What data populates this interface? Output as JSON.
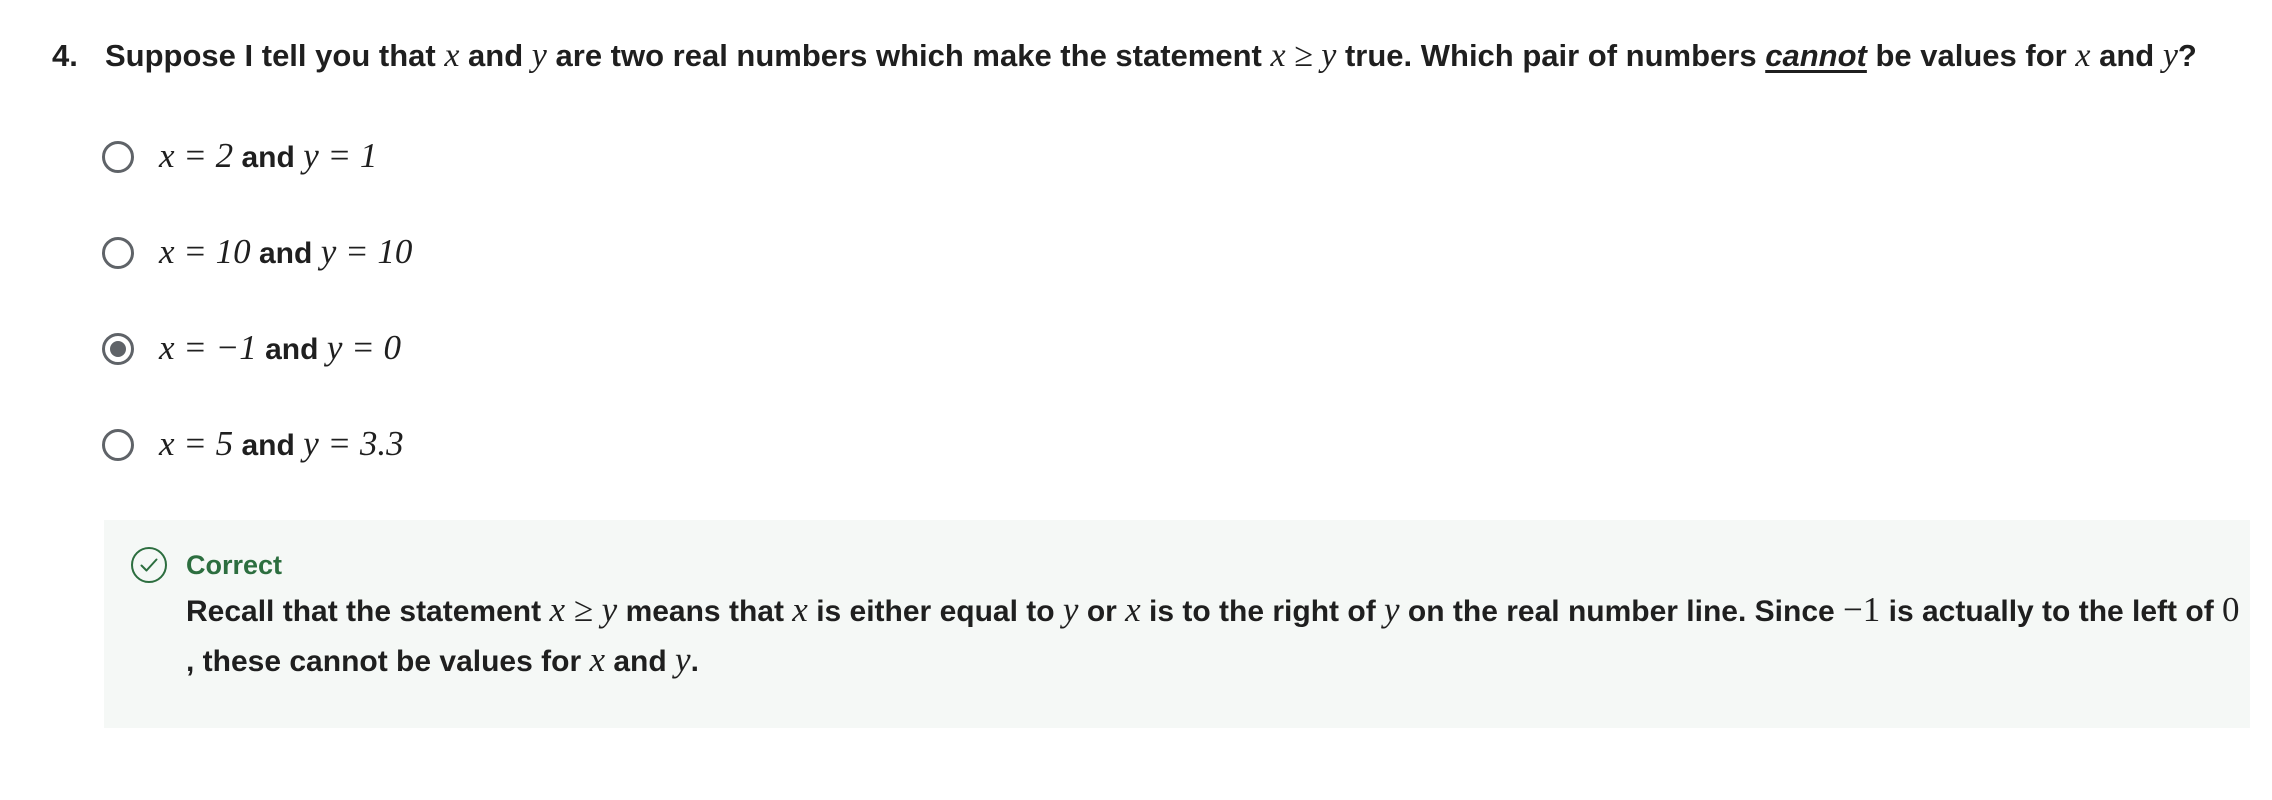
{
  "question": {
    "number": "4.",
    "text_1": "Suppose I tell you that",
    "var_x": "x",
    "text_2": "and",
    "var_y": "y",
    "text_3": "are two real numbers which make the statement",
    "statement": "x ≥ y",
    "text_4": "true. Which pair of numbers",
    "emphasis": "cannot",
    "text_5": "be values for",
    "text_6": "and",
    "text_end": "?"
  },
  "options": [
    {
      "x_part": "x = 2",
      "and": "and",
      "y_part": "y = 1",
      "selected": false
    },
    {
      "x_part": "x = 10",
      "and": "and",
      "y_part": "y = 10",
      "selected": false
    },
    {
      "x_part": "x = −1",
      "and": "and",
      "y_part": "y = 0",
      "selected": true
    },
    {
      "x_part": "x = 5",
      "and": "and",
      "y_part": "y = 3.3",
      "selected": false
    }
  ],
  "feedback": {
    "status": "Correct",
    "status_color": "#2c6e3f",
    "icon": "check-circle-icon",
    "line1": {
      "t1": "Recall that the statement",
      "m1": "x ≥ y",
      "t2": "means that",
      "m2": "x",
      "t3": "is either equal to",
      "m3": "y",
      "t4": "or",
      "m4": "x",
      "t5": "is to the right of",
      "m5": "y",
      "t6": "on the real number line. Since",
      "m6": "−1",
      "t7": "is actually to the left of",
      "m7": "0"
    },
    "line2": {
      "t1": ", these cannot be values for",
      "m1": "x",
      "t2": "and",
      "m2": "y",
      "t3": "."
    }
  }
}
